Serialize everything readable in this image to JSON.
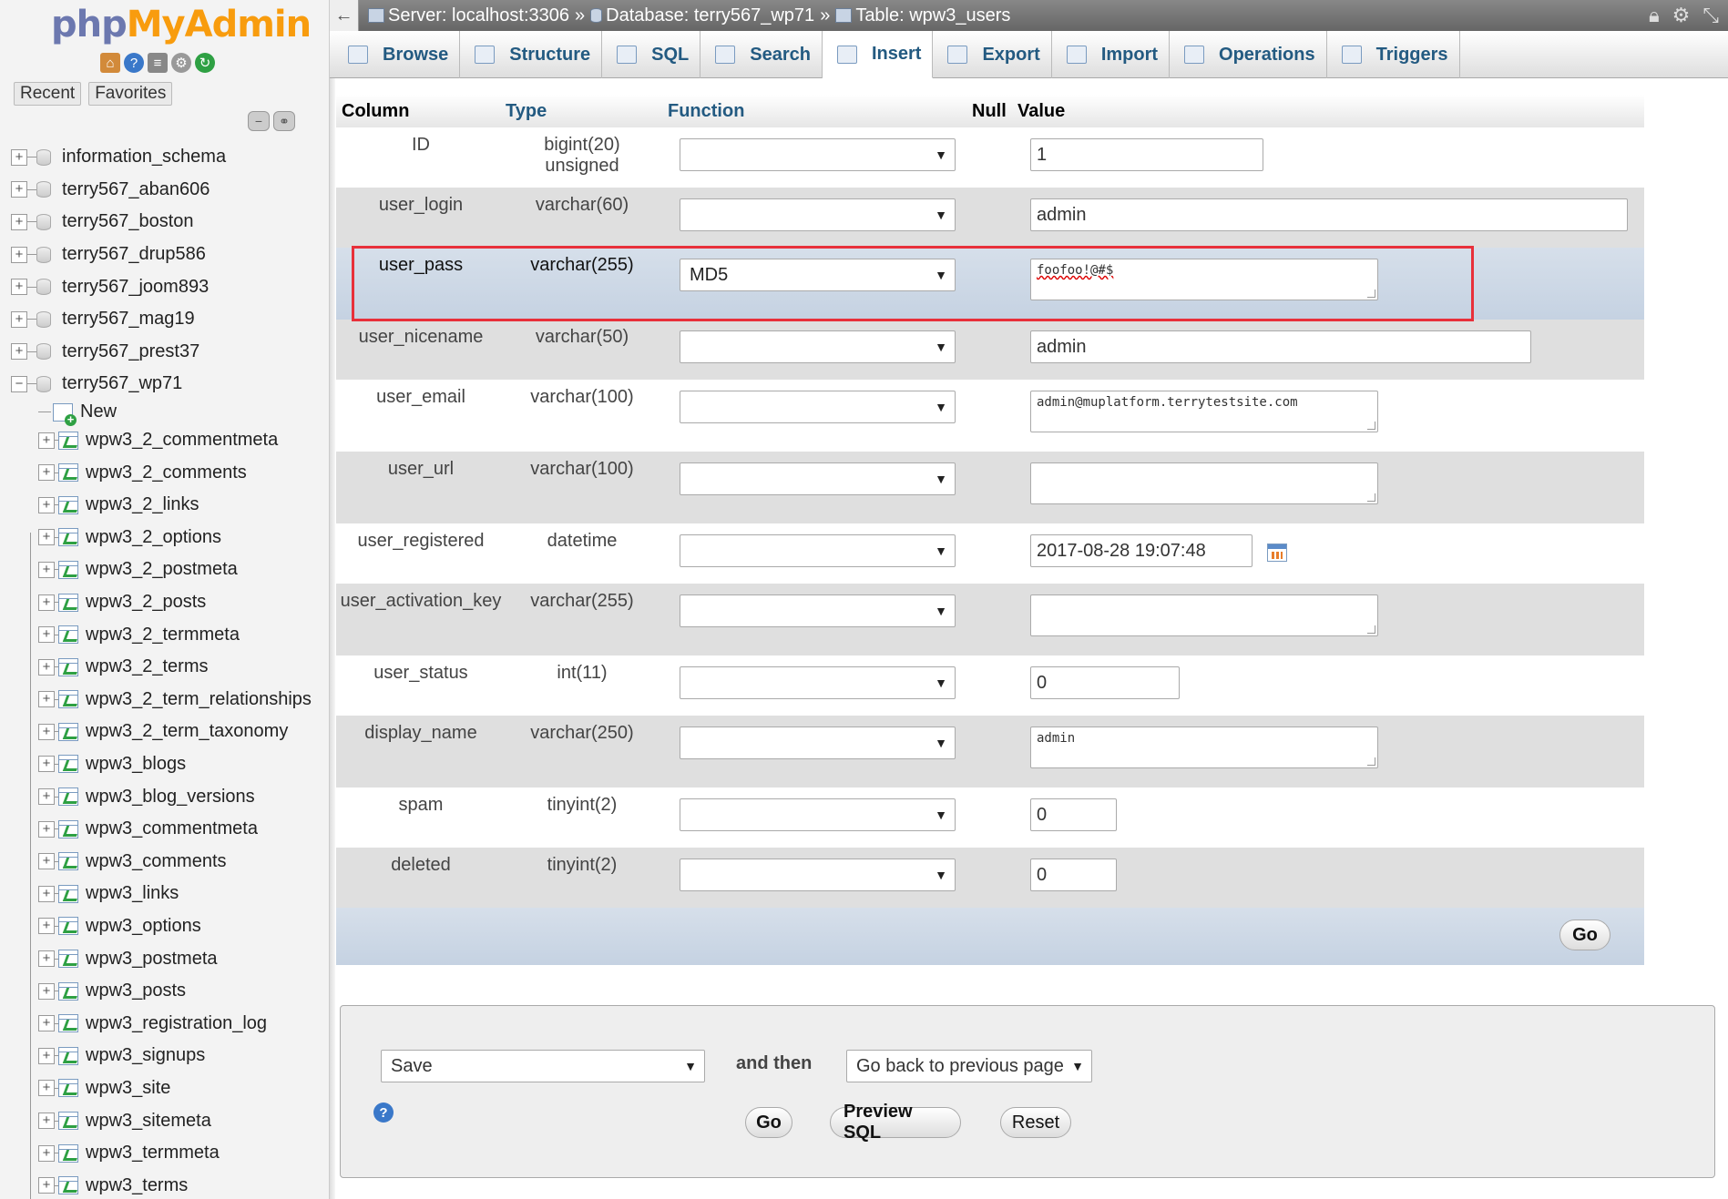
{
  "sidebar": {
    "logo": {
      "php": "php",
      "myadmin": "MyAdmin"
    },
    "icons": [
      "home-icon",
      "help-icon",
      "docs-icon",
      "settings-icon",
      "reload-icon"
    ],
    "nav_tabs": [
      "Recent",
      "Favorites"
    ],
    "databases": [
      "information_schema",
      "terry567_aban606",
      "terry567_boston",
      "terry567_drup586",
      "terry567_joom893",
      "terry567_mag19",
      "terry567_prest37",
      "terry567_wp71"
    ],
    "new_label": "New",
    "tables": [
      "wpw3_2_commentmeta",
      "wpw3_2_comments",
      "wpw3_2_links",
      "wpw3_2_options",
      "wpw3_2_postmeta",
      "wpw3_2_posts",
      "wpw3_2_termmeta",
      "wpw3_2_terms",
      "wpw3_2_term_relationships",
      "wpw3_2_term_taxonomy",
      "wpw3_blogs",
      "wpw3_blog_versions",
      "wpw3_commentmeta",
      "wpw3_comments",
      "wpw3_links",
      "wpw3_options",
      "wpw3_postmeta",
      "wpw3_posts",
      "wpw3_registration_log",
      "wpw3_signups",
      "wpw3_site",
      "wpw3_sitemeta",
      "wpw3_termmeta",
      "wpw3_terms"
    ]
  },
  "breadcrumb": {
    "server": "Server: localhost:3306",
    "database": "Database: terry567_wp71",
    "table": "Table: wpw3_users",
    "separator": "»"
  },
  "tabs": [
    {
      "label": "Browse",
      "icon": "browse-icon"
    },
    {
      "label": "Structure",
      "icon": "structure-icon"
    },
    {
      "label": "SQL",
      "icon": "sql-icon"
    },
    {
      "label": "Search",
      "icon": "search-icon"
    },
    {
      "label": "Insert",
      "icon": "insert-icon",
      "active": true
    },
    {
      "label": "Export",
      "icon": "export-icon"
    },
    {
      "label": "Import",
      "icon": "import-icon"
    },
    {
      "label": "Operations",
      "icon": "operations-icon"
    },
    {
      "label": "Triggers",
      "icon": "triggers-icon"
    }
  ],
  "grid": {
    "headers": {
      "column": "Column",
      "type": "Type",
      "function": "Function",
      "null": "Null",
      "value": "Value"
    },
    "rows": [
      {
        "column": "ID",
        "type": "bigint(20) unsigned",
        "function": "",
        "value": "1",
        "kind": "input"
      },
      {
        "column": "user_login",
        "type": "varchar(60)",
        "function": "",
        "value": "admin",
        "kind": "input"
      },
      {
        "column": "user_pass",
        "type": "varchar(255)",
        "function": "MD5",
        "value": "foofoo!@#$",
        "kind": "textarea",
        "highlighted": true
      },
      {
        "column": "user_nicename",
        "type": "varchar(50)",
        "function": "",
        "value": "admin",
        "kind": "input"
      },
      {
        "column": "user_email",
        "type": "varchar(100)",
        "function": "",
        "value": "admin@muplatform.terrytestsite.com",
        "kind": "textarea"
      },
      {
        "column": "user_url",
        "type": "varchar(100)",
        "function": "",
        "value": "",
        "kind": "textarea"
      },
      {
        "column": "user_registered",
        "type": "datetime",
        "function": "",
        "value": "2017-08-28 19:07:48",
        "kind": "input"
      },
      {
        "column": "user_activation_key",
        "type": "varchar(255)",
        "function": "",
        "value": "",
        "kind": "textarea"
      },
      {
        "column": "user_status",
        "type": "int(11)",
        "function": "",
        "value": "0",
        "kind": "input"
      },
      {
        "column": "display_name",
        "type": "varchar(250)",
        "function": "",
        "value": "admin",
        "kind": "textarea"
      },
      {
        "column": "spam",
        "type": "tinyint(2)",
        "function": "",
        "value": "0",
        "kind": "input"
      },
      {
        "column": "deleted",
        "type": "tinyint(2)",
        "function": "",
        "value": "0",
        "kind": "input"
      }
    ],
    "go_label": "Go"
  },
  "actions": {
    "save_select": "Save",
    "and_then": "and then",
    "after_select": "Go back to previous page",
    "go_label": "Go",
    "preview_sql_label": "Preview SQL",
    "reset_label": "Reset"
  },
  "colors": {
    "highlight_border": "#e8303a",
    "link_blue": "#235a81",
    "logo_php": "#6c78af",
    "logo_myadmin": "#f89c0e"
  }
}
